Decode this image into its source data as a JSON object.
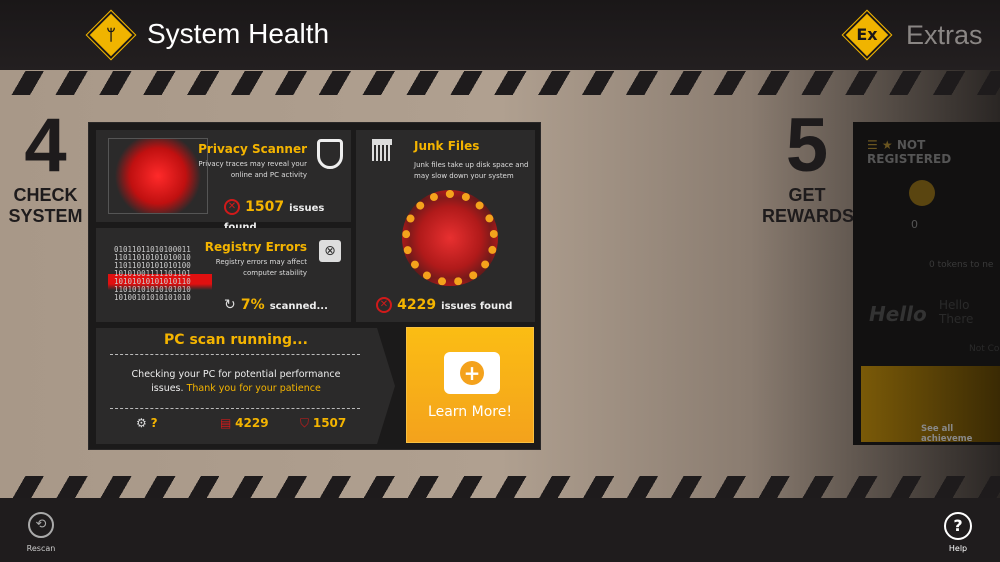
{
  "header": {
    "title": "System Health",
    "extras": "Extras",
    "title_icon": "stethoscope-icon",
    "extras_icon": "extras-icon",
    "extras_badge": "Ex"
  },
  "steps": {
    "check": {
      "number": "4",
      "line1": "CHECK",
      "line2": "SYSTEM"
    },
    "rewards": {
      "number": "5",
      "line1": "GET",
      "line2": "REWARDS"
    }
  },
  "privacy": {
    "title": "Privacy Scanner",
    "desc1": "Privacy traces may reveal your",
    "desc2": "online and PC activity",
    "count": "1507",
    "suffix": "issues found"
  },
  "registry": {
    "title": "Registry Errors",
    "desc1": "Registry errors may affect",
    "desc2": "computer stability",
    "progress": "7%",
    "suffix": "scanned...",
    "binary": [
      "01011011010100011",
      "11011010101010010",
      "11011010101010100",
      "10101001111101101",
      "10101010101010110",
      "11010101010101010",
      "10100101010101010"
    ]
  },
  "junk": {
    "title": "Junk Files",
    "desc1": "Junk files take up disk space and",
    "desc2": "may slow down your system",
    "count": "4229",
    "suffix": "issues found"
  },
  "scan": {
    "title": "PC scan running...",
    "text": "Checking your PC for potential performance issues.",
    "thanks": "Thank you for your patience",
    "registry_count": "?",
    "junk_count": "4229",
    "privacy_count": "1507"
  },
  "learn_more": {
    "label": "Learn More!"
  },
  "rewards": {
    "status": "NOT REGISTERED",
    "tokens": "0",
    "tokens_text": "0 tokens to ne",
    "hello": "Hello There",
    "not_connected": "Not Co",
    "achievements": "See all achieveme"
  },
  "bottom": {
    "rescan": "Rescan",
    "help": "Help"
  },
  "colors": {
    "accent": "#f4b400",
    "danger": "#d01a1a",
    "panel": "#2b2a2a",
    "header": "#1f1c1d"
  }
}
